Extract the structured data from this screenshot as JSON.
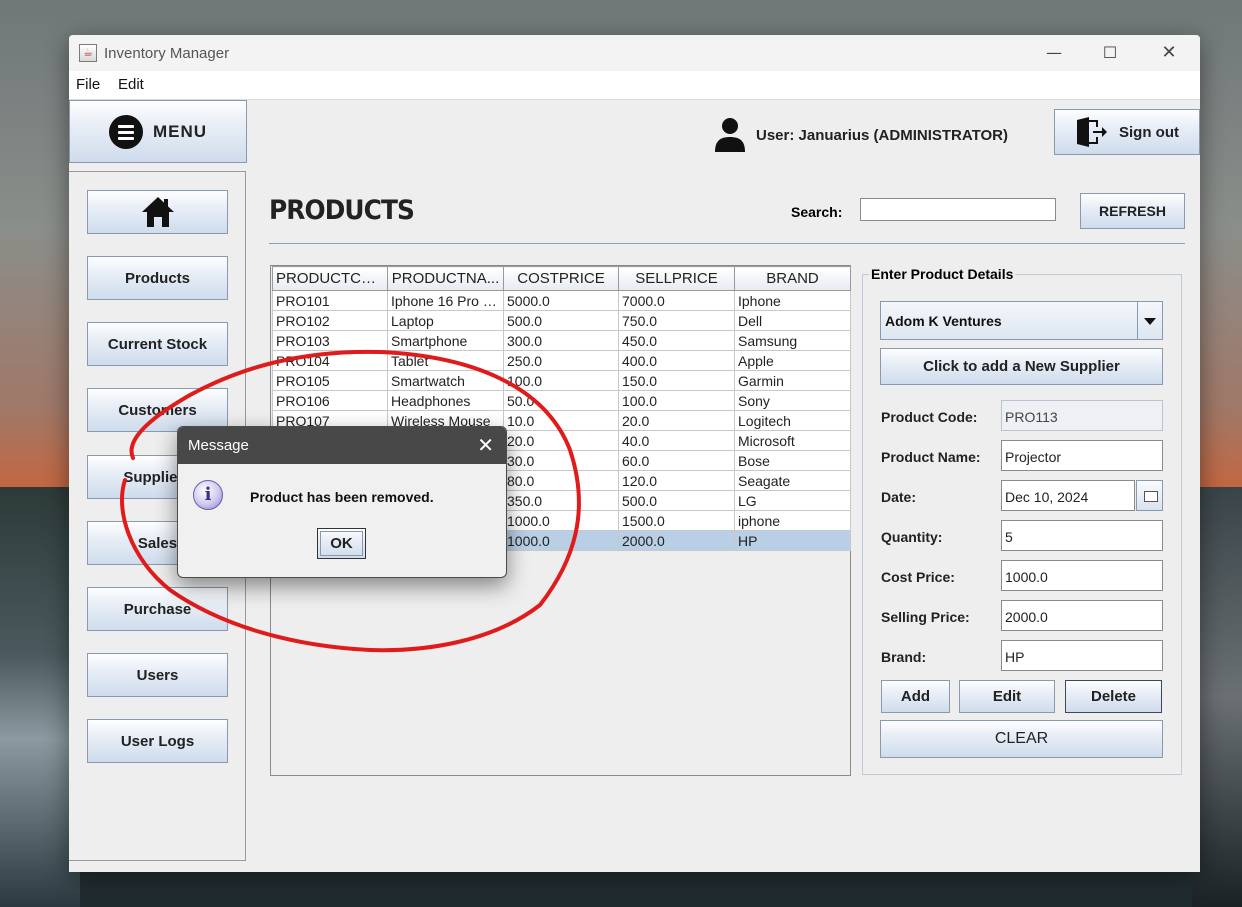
{
  "window": {
    "title": "Inventory Manager"
  },
  "menubar": [
    "File",
    "Edit"
  ],
  "menu_header": {
    "label": "MENU"
  },
  "sidebar": {
    "items": [
      {
        "label": ""
      },
      {
        "label": "Products"
      },
      {
        "label": "Current Stock"
      },
      {
        "label": "Customers"
      },
      {
        "label": "Suppliers"
      },
      {
        "label": "Sales"
      },
      {
        "label": "Purchase"
      },
      {
        "label": "Users"
      },
      {
        "label": "User Logs"
      }
    ]
  },
  "header": {
    "user_label": "User: Januarius (ADMINISTRATOR)",
    "signout_label": "Sign out"
  },
  "page": {
    "title": "PRODUCTS",
    "search_label": "Search:",
    "search_value": "",
    "refresh_label": "REFRESH"
  },
  "table": {
    "columns": [
      "PRODUCTCO...",
      "PRODUCTNA...",
      "COSTPRICE",
      "SELLPRICE",
      "BRAND"
    ],
    "rows": [
      [
        "PRO101",
        "Iphone 16 Pro M...",
        "5000.0",
        "7000.0",
        "Iphone"
      ],
      [
        "PRO102",
        "Laptop",
        "500.0",
        "750.0",
        "Dell"
      ],
      [
        "PRO103",
        "Smartphone",
        "300.0",
        "450.0",
        "Samsung"
      ],
      [
        "PRO104",
        "Tablet",
        "250.0",
        "400.0",
        "Apple"
      ],
      [
        "PRO105",
        "Smartwatch",
        "100.0",
        "150.0",
        "Garmin"
      ],
      [
        "PRO106",
        "Headphones",
        "50.0",
        "100.0",
        "Sony"
      ],
      [
        "PRO107",
        "Wireless Mouse",
        "10.0",
        "20.0",
        "Logitech"
      ],
      [
        "",
        "",
        "20.0",
        "40.0",
        "Microsoft"
      ],
      [
        "",
        "",
        "30.0",
        "60.0",
        "Bose"
      ],
      [
        "",
        "",
        "80.0",
        "120.0",
        "Seagate"
      ],
      [
        "",
        "",
        "350.0",
        "500.0",
        "LG"
      ],
      [
        "",
        "",
        "1000.0",
        "1500.0",
        "iphone"
      ],
      [
        "",
        "",
        "1000.0",
        "2000.0",
        "HP"
      ]
    ],
    "selected_row": 12
  },
  "details": {
    "legend": "Enter Product Details",
    "supplier_selected": "Adom K Ventures",
    "add_supplier_label": "Click to add a New Supplier",
    "fields": {
      "product_code": {
        "label": "Product Code:",
        "value": "PRO113"
      },
      "product_name": {
        "label": "Product Name:",
        "value": "Projector"
      },
      "date": {
        "label": "Date:",
        "value": "Dec 10, 2024"
      },
      "quantity": {
        "label": "Quantity:",
        "value": "5"
      },
      "cost_price": {
        "label": "Cost Price:",
        "value": "1000.0"
      },
      "selling_price": {
        "label": "Selling Price:",
        "value": "2000.0"
      },
      "brand": {
        "label": "Brand:",
        "value": "HP"
      }
    },
    "buttons": {
      "add": "Add",
      "edit": "Edit",
      "delete": "Delete",
      "clear": "CLEAR"
    }
  },
  "dialog": {
    "title": "Message",
    "message": "Product has been removed.",
    "ok_label": "OK"
  },
  "icons": {
    "app": "java-cup-icon",
    "menu": "hamburger-icon",
    "home": "home-icon",
    "user": "user-icon",
    "signout": "exit-door-icon",
    "info": "info-icon",
    "calendar": "calendar-icon"
  },
  "colors": {
    "annotation_stroke": "#e01b1b",
    "selected_row": "#b8cfe5",
    "dialog_titlebar": "#484848"
  }
}
